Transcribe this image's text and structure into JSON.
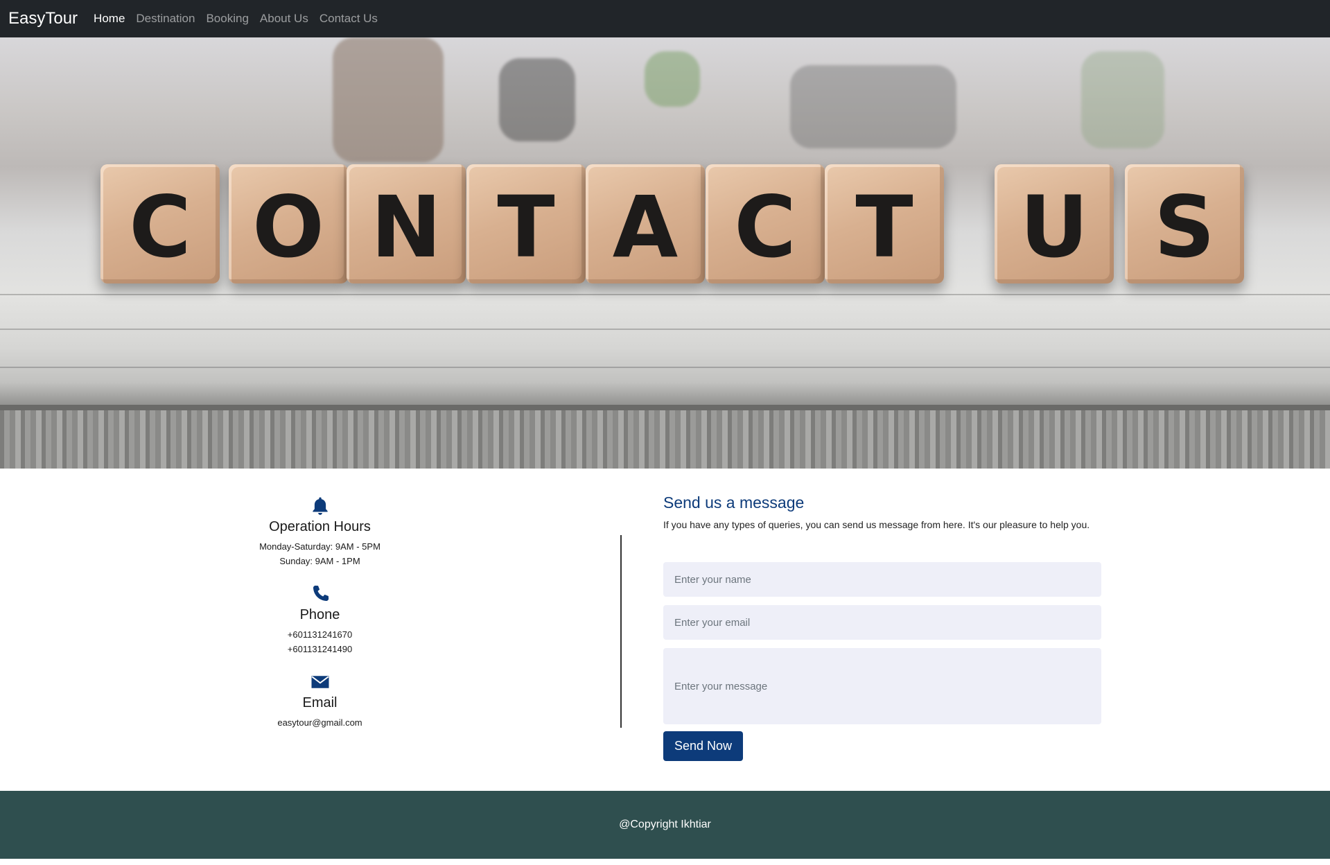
{
  "navbar": {
    "brand": "EasyTour",
    "links": [
      {
        "label": "Home",
        "active": true
      },
      {
        "label": "Destination",
        "active": false
      },
      {
        "label": "Booking",
        "active": false
      },
      {
        "label": "About Us",
        "active": false
      },
      {
        "label": "Contact Us",
        "active": false
      }
    ]
  },
  "hero": {
    "letters": [
      "C",
      "O",
      "N",
      "T",
      "A",
      "C",
      "T",
      "U",
      "S"
    ]
  },
  "info": {
    "hours": {
      "icon": "bell-icon",
      "title": "Operation Hours",
      "lines": [
        "Monday-Saturday: 9AM - 5PM",
        "Sunday: 9AM - 1PM"
      ]
    },
    "phone": {
      "icon": "phone-icon",
      "title": "Phone",
      "lines": [
        "+601131241670",
        "+601131241490"
      ]
    },
    "email": {
      "icon": "envelope-icon",
      "title": "Email",
      "lines": [
        "easytour@gmail.com"
      ]
    }
  },
  "form": {
    "title": "Send us a message",
    "description": "If you have any types of queries, you can send us message from here. It's our pleasure to help you.",
    "name_placeholder": "Enter your name",
    "email_placeholder": "Enter your email",
    "message_placeholder": "Enter your message",
    "submit_label": "Send Now"
  },
  "footer": {
    "copyright": "@Copyright Ikhtiar"
  },
  "colors": {
    "navbar": "#212529",
    "accent": "#0d3b7a",
    "field_bg": "#eeeff8",
    "footer": "#2f4f4f"
  }
}
